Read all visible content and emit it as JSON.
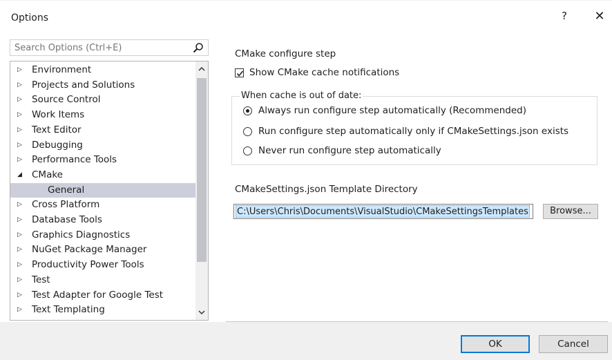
{
  "window": {
    "title": "Options",
    "help_label": "?",
    "close_label": "✕"
  },
  "search": {
    "placeholder": "Search Options (Ctrl+E)",
    "icon": "search-icon"
  },
  "tree": {
    "items": [
      {
        "label": "Environment",
        "arrow": "▷"
      },
      {
        "label": "Projects and Solutions",
        "arrow": "▷"
      },
      {
        "label": "Source Control",
        "arrow": "▷"
      },
      {
        "label": "Work Items",
        "arrow": "▷"
      },
      {
        "label": "Text Editor",
        "arrow": "▷"
      },
      {
        "label": "Debugging",
        "arrow": "▷"
      },
      {
        "label": "Performance Tools",
        "arrow": "▷"
      },
      {
        "label": "CMake",
        "arrow": "◢"
      },
      {
        "label": "General",
        "arrow": ""
      },
      {
        "label": "Cross Platform",
        "arrow": "▷"
      },
      {
        "label": "Database Tools",
        "arrow": "▷"
      },
      {
        "label": "Graphics Diagnostics",
        "arrow": "▷"
      },
      {
        "label": "NuGet Package Manager",
        "arrow": "▷"
      },
      {
        "label": "Productivity Power Tools",
        "arrow": "▷"
      },
      {
        "label": "Test",
        "arrow": "▷"
      },
      {
        "label": "Test Adapter for Google Test",
        "arrow": "▷"
      },
      {
        "label": "Text Templating",
        "arrow": "▷"
      }
    ],
    "selected_index": 8,
    "scroll_up": "^",
    "scroll_down": "v"
  },
  "panel": {
    "section_title": "CMake configure step",
    "show_cache_notifications": {
      "label": "Show CMake cache notifications",
      "checked": true
    },
    "group_title": "When cache is out of date:",
    "radios": [
      {
        "label": "Always run configure step automatically (Recommended)",
        "checked": true
      },
      {
        "label": "Run configure step automatically only if CMakeSettings.json exists",
        "checked": false
      },
      {
        "label": "Never run configure step automatically",
        "checked": false
      }
    ],
    "template_dir_label": "CMakeSettings.json Template Directory",
    "template_dir_value": "C:\\Users\\Chris\\Documents\\VisualStudio\\CMakeSettingsTemplates",
    "browse_label": "Browse..."
  },
  "footer": {
    "ok_label": "OK",
    "cancel_label": "Cancel"
  }
}
